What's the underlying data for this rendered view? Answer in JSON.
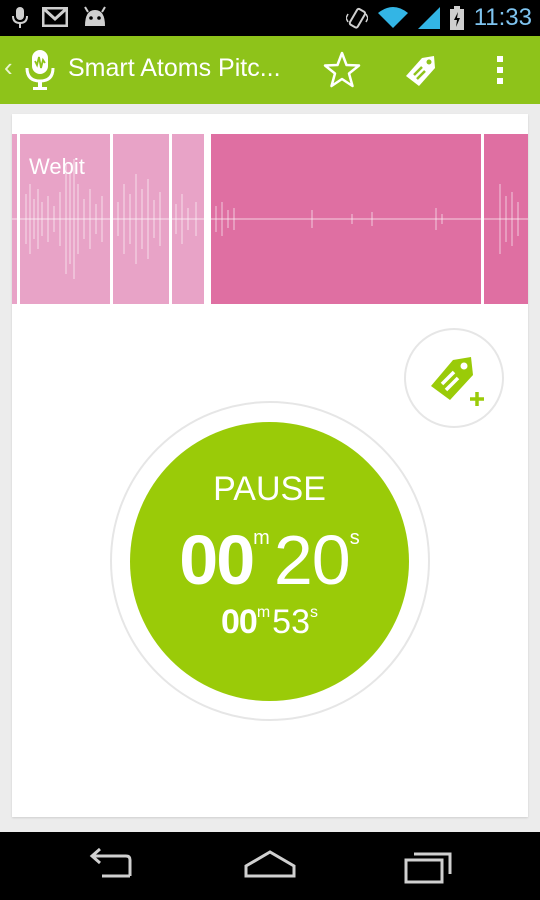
{
  "status_bar": {
    "time": "11:33",
    "left_icons": [
      "microphone-icon",
      "gmail-icon",
      "android-icon"
    ],
    "right_icons": [
      "vibrate-icon",
      "wifi-icon",
      "signal-icon",
      "battery-icon"
    ]
  },
  "action_bar": {
    "title": "Smart Atoms Pitc...",
    "back_glyph": "‹",
    "background_color": "#8ec31a"
  },
  "waveform": {
    "label": "Webit",
    "segment_color_light": "#e8a3c7",
    "segment_color_dark": "#df6fa2"
  },
  "timer": {
    "state_label": "PAUSE",
    "current_minutes": "00",
    "current_minutes_unit": "m",
    "current_seconds": "20",
    "current_seconds_unit": "s",
    "total_minutes": "00",
    "total_minutes_unit": "m",
    "total_seconds": "53",
    "total_seconds_unit": "s",
    "color": "#9acb08"
  },
  "nav_bar": {
    "buttons": [
      "back-icon",
      "home-icon",
      "recent-apps-icon"
    ]
  }
}
